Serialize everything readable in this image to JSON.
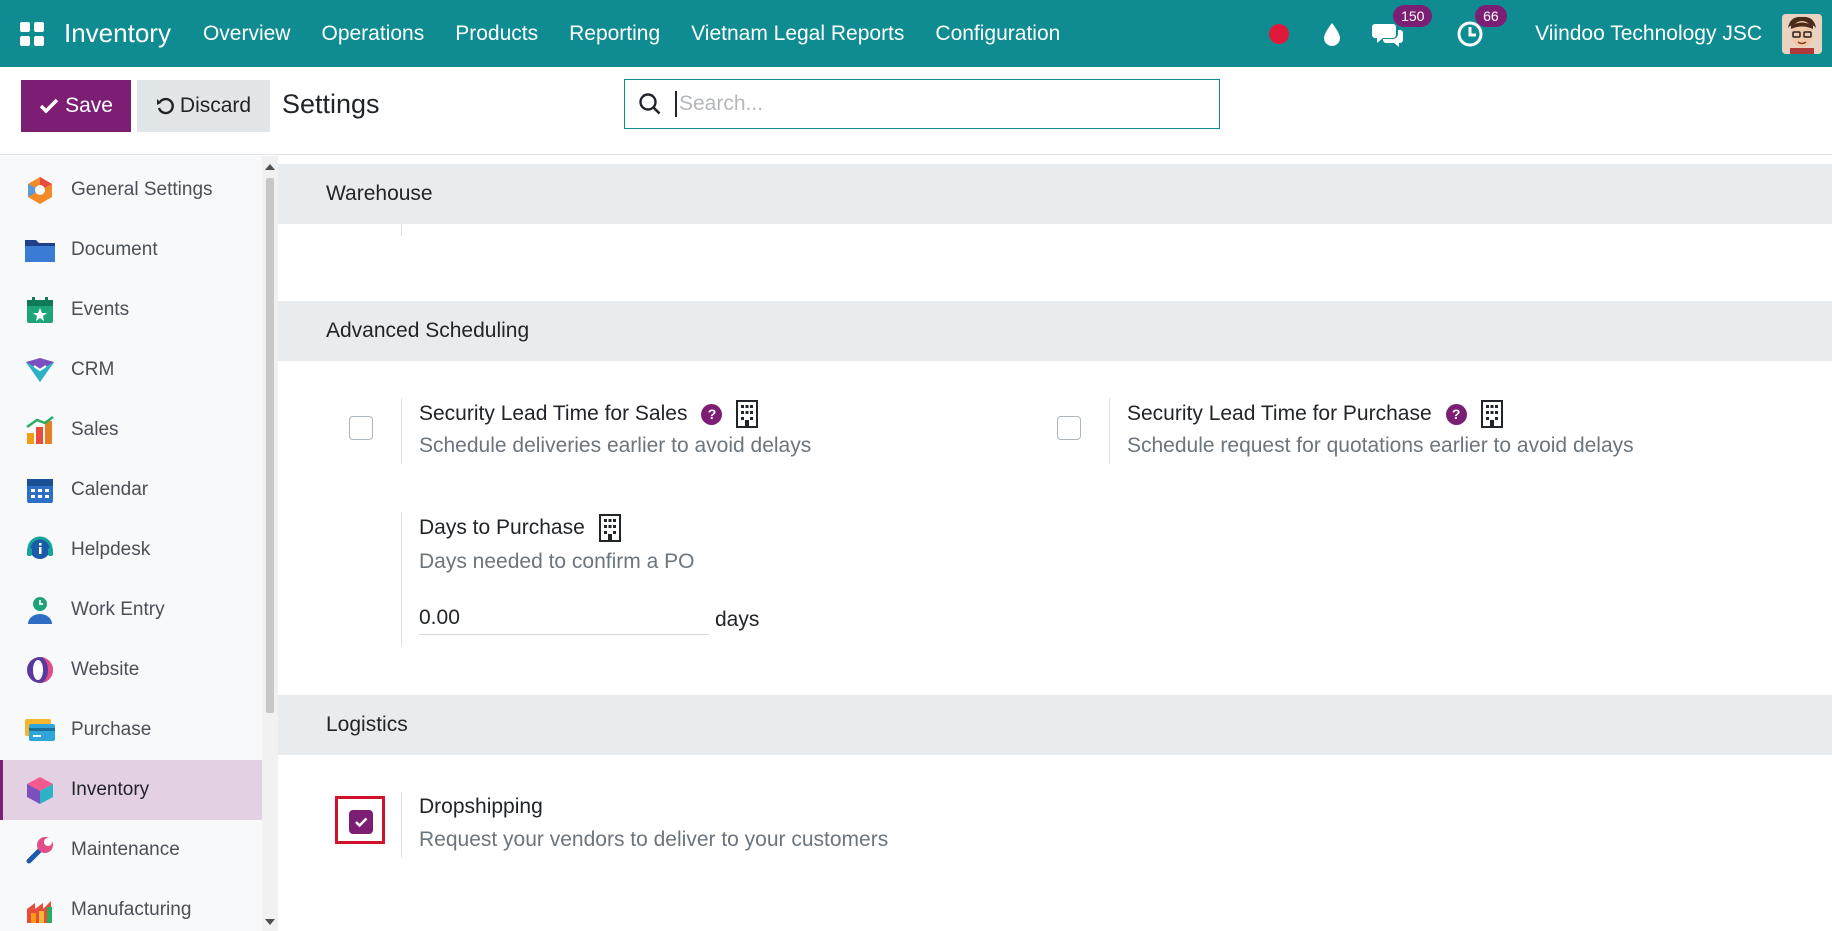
{
  "navbar": {
    "brand": "Inventory",
    "menu": [
      "Overview",
      "Operations",
      "Products",
      "Reporting",
      "Vietnam Legal Reports",
      "Configuration"
    ],
    "messages_badge": "150",
    "activities_badge": "66",
    "company": "Viindoo Technology JSC"
  },
  "control": {
    "save_label": "Save",
    "discard_label": "Discard",
    "title": "Settings",
    "search_placeholder": "Search..."
  },
  "sidebar": {
    "items": [
      {
        "label": "General Settings",
        "icon": "general-settings-icon"
      },
      {
        "label": "Document",
        "icon": "folder-icon"
      },
      {
        "label": "Events",
        "icon": "calendar-star-icon"
      },
      {
        "label": "CRM",
        "icon": "crm-icon"
      },
      {
        "label": "Sales",
        "icon": "chart-bars-icon"
      },
      {
        "label": "Calendar",
        "icon": "calendar-icon"
      },
      {
        "label": "Helpdesk",
        "icon": "headset-icon"
      },
      {
        "label": "Work Entry",
        "icon": "work-entry-icon"
      },
      {
        "label": "Website",
        "icon": "website-icon"
      },
      {
        "label": "Purchase",
        "icon": "credit-card-icon"
      },
      {
        "label": "Inventory",
        "icon": "cube-icon",
        "active": true
      },
      {
        "label": "Maintenance",
        "icon": "wrench-icon"
      },
      {
        "label": "Manufacturing",
        "icon": "factory-icon"
      }
    ]
  },
  "sections": {
    "warehouse": "Warehouse",
    "advanced_scheduling": "Advanced Scheduling",
    "logistics": "Logistics"
  },
  "settings": {
    "lead_sales": {
      "title": "Security Lead Time for Sales",
      "desc": "Schedule deliveries earlier to avoid delays",
      "checked": false
    },
    "lead_purchase": {
      "title": "Security Lead Time for Purchase",
      "desc": "Schedule request for quotations earlier to avoid delays",
      "checked": false
    },
    "days_purchase": {
      "title": "Days to Purchase",
      "desc": "Days needed to confirm a PO",
      "value": "0.00",
      "unit": "days"
    },
    "dropshipping": {
      "title": "Dropshipping",
      "desc": "Request your vendors to deliver to your customers",
      "checked": true
    }
  },
  "colors": {
    "navbar": "#0e8c92",
    "primary": "#7c1f74",
    "highlight": "#d0112b"
  }
}
